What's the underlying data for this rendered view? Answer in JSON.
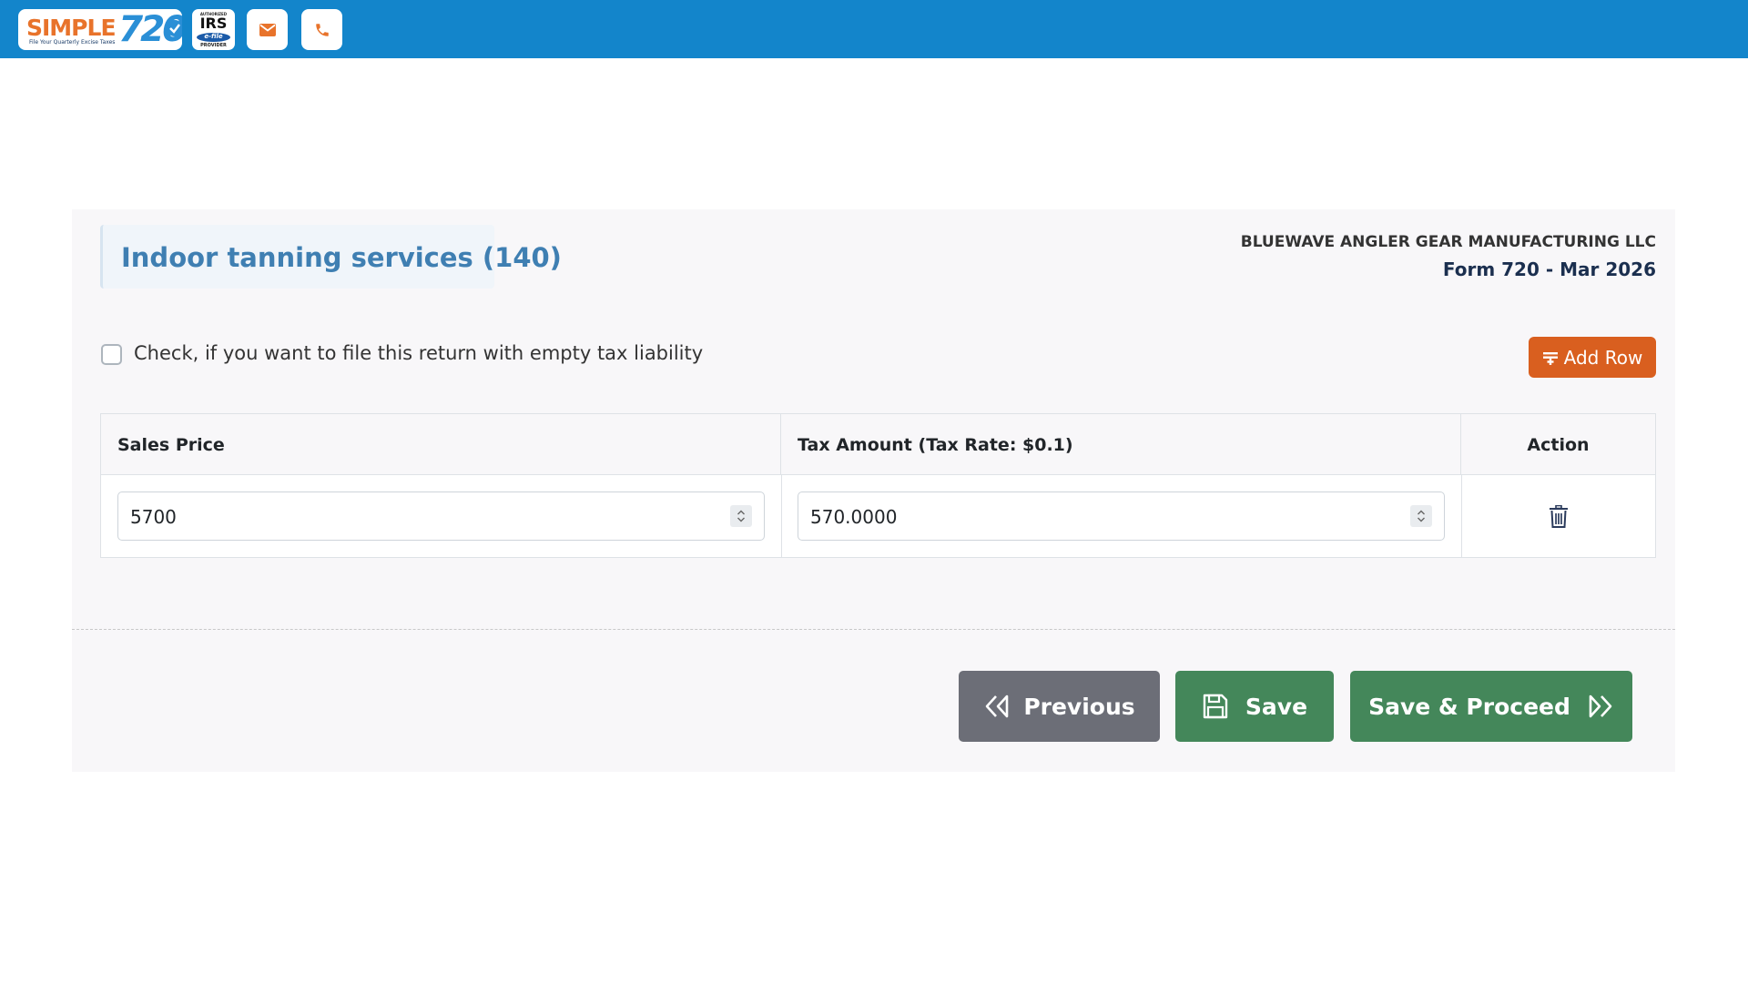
{
  "header": {
    "logo": {
      "brand": "SIMPLE",
      "number": "720",
      "tagline": "File Your Quarterly Excise Taxes"
    },
    "irs_badge": {
      "authorized": "AUTHORIZED",
      "main": "IRS",
      "efile": "e-file",
      "provider": "PROVIDER"
    },
    "icons": [
      "envelope-icon",
      "phone-icon"
    ]
  },
  "section": {
    "title": "Indoor tanning services (140)",
    "company": "BLUEWAVE ANGLER GEAR MANUFACTURING LLC",
    "form": "Form 720 - Mar 2026"
  },
  "empty_liability": {
    "checked": false,
    "label": "Check, if you want to file this return with empty tax liability"
  },
  "add_row_label": "Add Row",
  "table": {
    "headers": [
      "Sales Price",
      "Tax Amount (Tax Rate: $0.1)",
      "Action"
    ],
    "rows": [
      {
        "sales_price": "5700",
        "tax_amount": "570.0000"
      }
    ]
  },
  "footer": {
    "previous_label": "Previous",
    "save_label": "Save",
    "proceed_label": "Save & Proceed"
  },
  "colors": {
    "topbar": "#1385cb",
    "title": "#3f7fb2",
    "add_row": "#d95f1f",
    "previous": "#6c6e77",
    "save": "#44875a"
  }
}
